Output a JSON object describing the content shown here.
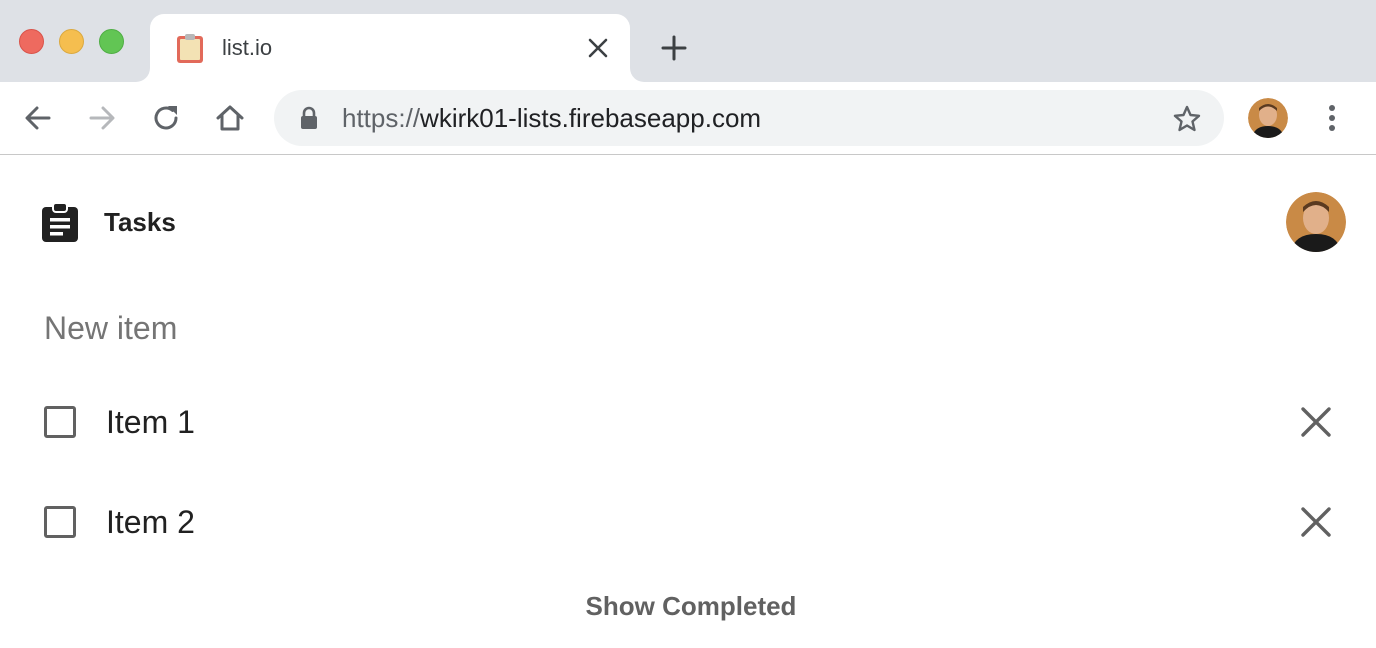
{
  "browser": {
    "tab": {
      "title": "list.io",
      "favicon": "clipboard-favicon"
    },
    "url": {
      "scheme": "https://",
      "host": "wkirk01-lists.firebaseapp.com"
    },
    "icons": {
      "back": "back-arrow-icon",
      "forward": "forward-arrow-icon",
      "reload": "reload-icon",
      "home": "home-icon",
      "lock": "lock-icon",
      "bookmark": "star-icon",
      "menu": "more-vert-icon",
      "close_tab": "close-icon",
      "new_tab": "plus-icon"
    }
  },
  "app": {
    "title": "Tasks",
    "logo_icon": "assignment-icon",
    "new_item_placeholder": "New item",
    "items": [
      {
        "label": "Item 1",
        "checked": false
      },
      {
        "label": "Item 2",
        "checked": false
      }
    ],
    "show_completed_label": "Show Completed"
  },
  "colors": {
    "chrome_bg": "#dee1e6",
    "omnibox_bg": "#f1f3f4",
    "text_primary": "#212121",
    "text_secondary": "#616161",
    "placeholder": "#757575"
  }
}
